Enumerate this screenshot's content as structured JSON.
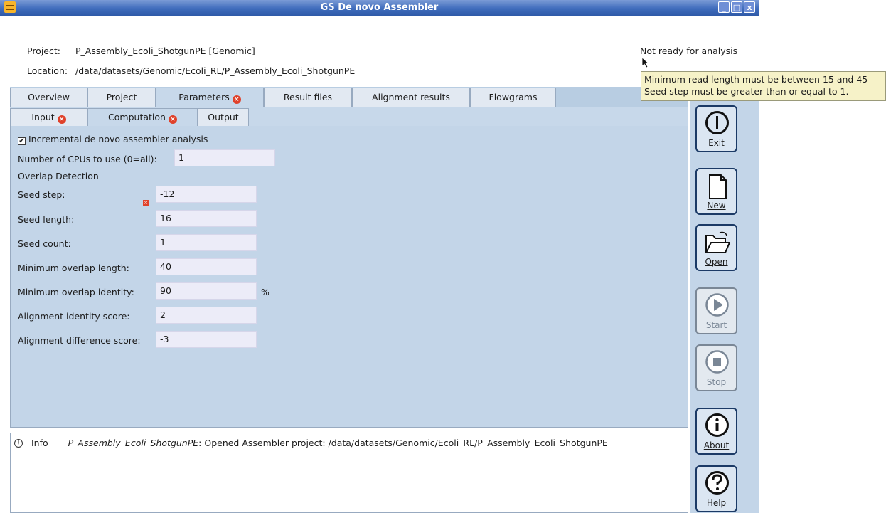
{
  "window": {
    "title": "GS De novo Assembler",
    "controls": [
      "_",
      "□",
      "x"
    ]
  },
  "project": {
    "project_label": "Project:",
    "project_value": "P_Assembly_Ecoli_ShotgunPE  [Genomic]",
    "location_label": "Location:",
    "location_value": "/data/datasets/Genomic/Ecoli_RL/P_Assembly_Ecoli_ShotgunPE",
    "status": "Not ready for analysis"
  },
  "tooltip": {
    "line1": "Minimum read length must be between 15 and 45",
    "line2": "Seed step must be greater than or equal to 1."
  },
  "tabs": [
    {
      "label": "Overview"
    },
    {
      "label": "Project"
    },
    {
      "label": "Parameters"
    },
    {
      "label": "Result files"
    },
    {
      "label": "Alignment results"
    },
    {
      "label": "Flowgrams"
    }
  ],
  "subtabs": [
    {
      "label": "Input"
    },
    {
      "label": "Computation"
    },
    {
      "label": "Output"
    }
  ],
  "computation": {
    "incremental_label": "Incremental de novo assembler analysis",
    "incremental_checked": true,
    "cpus_label": "Number of CPUs to use (0=all):",
    "cpus_value": "1",
    "overlap_section": "Overlap Detection",
    "fields": [
      {
        "label": "Seed step:",
        "value": "-12"
      },
      {
        "label": "Seed length:",
        "value": "16"
      },
      {
        "label": "Seed count:",
        "value": "1"
      },
      {
        "label": "Minimum overlap length:",
        "value": "40"
      },
      {
        "label": "Minimum overlap identity:",
        "value": "90"
      },
      {
        "label": "Alignment identity score:",
        "value": "2"
      },
      {
        "label": "Alignment difference score:",
        "value": "-3"
      }
    ],
    "percent_unit": "%"
  },
  "log": {
    "level": "Info",
    "project": "P_Assembly_Ecoli_ShotgunPE",
    "message": ": Opened Assembler project: /data/datasets/Genomic/Ecoli_RL/P_Assembly_Ecoli_ShotgunPE"
  },
  "sidebar": {
    "buttons": [
      {
        "label": "Exit",
        "icon": "power-icon",
        "enabled": true
      },
      {
        "label": "New",
        "icon": "new-document-icon",
        "enabled": true
      },
      {
        "label": "Open",
        "icon": "open-folder-icon",
        "enabled": true
      },
      {
        "label": "Start",
        "icon": "play-icon",
        "enabled": false
      },
      {
        "label": "Stop",
        "icon": "stop-icon",
        "enabled": false
      },
      {
        "label": "About",
        "icon": "info-icon",
        "enabled": true
      },
      {
        "label": "Help",
        "icon": "help-icon",
        "enabled": true
      }
    ]
  },
  "colors": {
    "titlebar": "#3f6cbc",
    "panel": "#c3d5e8",
    "error": "#e0412a",
    "tooltip_bg": "#f6f2c8"
  }
}
